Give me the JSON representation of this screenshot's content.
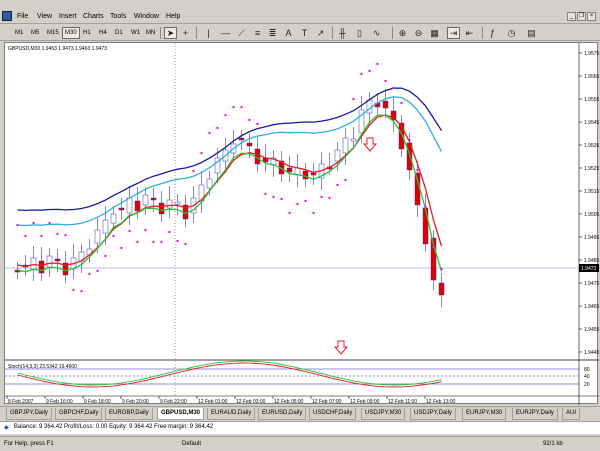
{
  "menu": {
    "items": [
      "File",
      "View",
      "Insert",
      "Charts",
      "Tools",
      "Window",
      "Help"
    ]
  },
  "toolbar": {
    "timeframes": [
      "M1",
      "M5",
      "M15",
      "M30",
      "H1",
      "H4",
      "D1",
      "W1",
      "MN"
    ],
    "active_timeframe": "M30"
  },
  "chart": {
    "info": "GBPUSD,M30 1.9453 1.9473 1.9463 1.9473",
    "stoch_label": "Stoch(14,3,3) 23.5342 19.4600",
    "colors": {
      "bull_body": "#ffffff",
      "bear_body": "#e00000",
      "candle_outline": "#3a3aa8",
      "ma_slow": "#1a1aa0",
      "ma_mid": "#30b0e0",
      "ma_fast": "#e02020",
      "ma_fastest": "#30c030",
      "sar": "#e020e0",
      "bid_line": "#a0b0d8",
      "arrow": "#e02020"
    },
    "price_ticks": [
      "1.9575",
      "1.9565",
      "1.9555",
      "1.9545",
      "1.9535",
      "1.9525",
      "1.9515",
      "1.9505",
      "1.9495",
      "1.9485",
      "1.9475",
      "1.9465",
      "1.9455",
      "1.9445"
    ],
    "current_price": "1.9473",
    "time_ticks": [
      "8 Feb 2007",
      "9 Feb 16:00",
      "9 Feb 18:00",
      "9 Feb 20:00",
      "9 Feb 22:00",
      "12 Feb 01:00",
      "12 Feb 03:00",
      "12 Feb 05:00",
      "12 Feb 07:00",
      "12 Feb 09:00",
      "12 Feb 11:00",
      "12 Feb 13:00"
    ],
    "stoch_ticks": [
      "80",
      "40",
      "20"
    ]
  },
  "tabs": {
    "items": [
      "GBPJPY,Daily",
      "GBPCHF,Daily",
      "EURGBP,Daily",
      "GBPUSD,M30",
      "EURAUD,Daily",
      "EURUSD,Daily",
      "USDCHF,Daily",
      "USDJPY,M30",
      "USDJPY,Daily",
      "EURJPY,M30",
      "EURJPY,Daily",
      "AUI"
    ],
    "active_index": 3
  },
  "balance": {
    "text": "Balance: 9 364.42  Profit/Loss: 0.00  Equity: 9 364.42  Free margin: 9 364.42"
  },
  "status": {
    "help": "For Help, press F1",
    "profile": "Default",
    "traffic": "92/1 kb"
  }
}
